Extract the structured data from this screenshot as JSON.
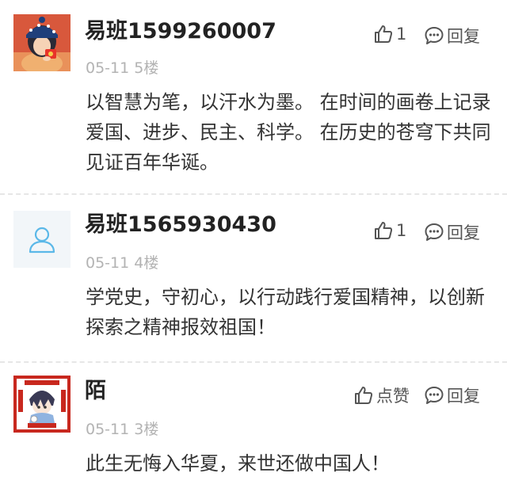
{
  "comments": [
    {
      "username": "易班1599260007",
      "date": "05-11",
      "floor": "5楼",
      "text": "以智慧为笔，以汗水为墨。 在时间的画卷上记录爱国、进步、民主、科学。 在历史的苍穹下共同见证百年华诞。",
      "like_label": "1",
      "reply_label": "回复",
      "avatar_icon": "girl-red-hat-avatar"
    },
    {
      "username": "易班1565930430",
      "date": "05-11",
      "floor": "4楼",
      "text": "学党史，守初心，以行动践行爱国精神，以创新探索之精神报效祖国！",
      "like_label": "1",
      "reply_label": "回复",
      "avatar_icon": "default-user-avatar"
    },
    {
      "username": "陌",
      "date": "05-11",
      "floor": "3楼",
      "text": "此生无悔入华夏，来世还做中国人！",
      "like_label": "点赞",
      "reply_label": "回复",
      "avatar_icon": "anime-boy-avatar"
    }
  ],
  "colors": {
    "text": "#333333",
    "meta": "#b3b3b3",
    "divider": "#e6e6e6",
    "avatar_placeholder_icon": "#5bb8e8"
  }
}
